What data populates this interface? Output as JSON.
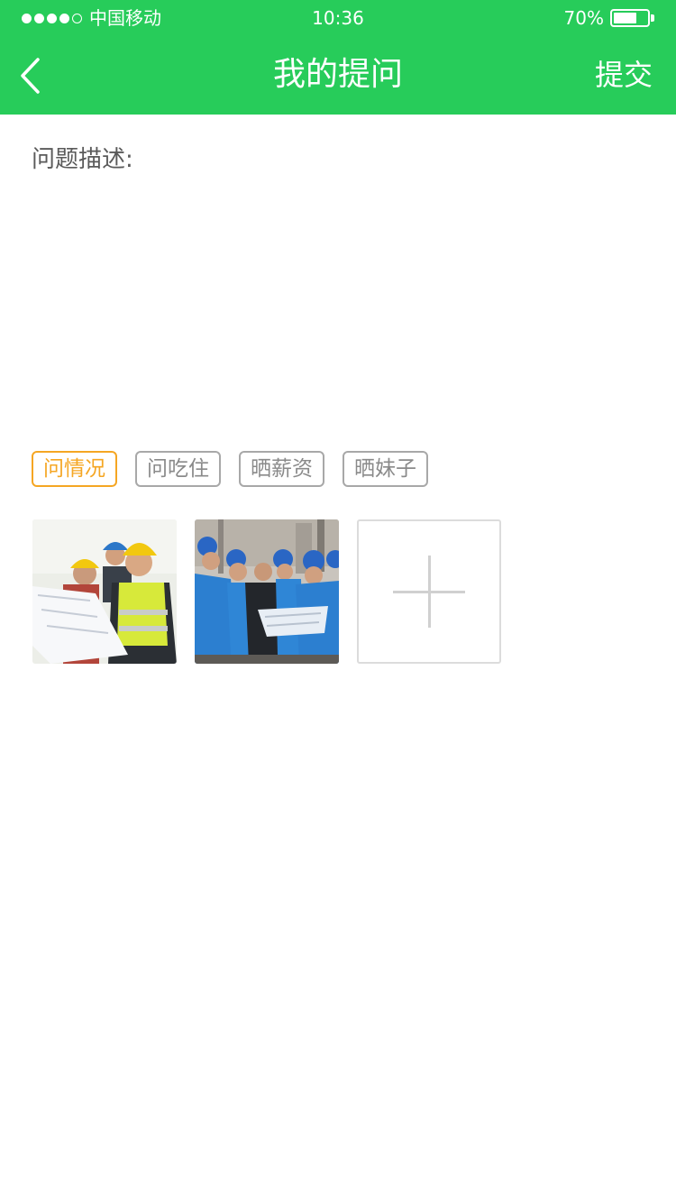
{
  "status_bar": {
    "carrier": "中国移动",
    "time": "10:36",
    "battery_percent": "70%",
    "battery_level": 0.7,
    "signal_bars": 4,
    "signal_total": 5
  },
  "nav": {
    "back_icon": "chevron-left-icon",
    "title": "我的提问",
    "submit_label": "提交"
  },
  "form": {
    "description_label": "问题描述:",
    "description_value": ""
  },
  "tags": [
    {
      "label": "问情况",
      "active": true
    },
    {
      "label": "问吃住",
      "active": false
    },
    {
      "label": "晒薪资",
      "active": false
    },
    {
      "label": "晒妹子",
      "active": false
    }
  ],
  "photos": {
    "add_icon": "plus-icon"
  },
  "colors": {
    "brand": "#27cc5a",
    "tag_active": "#f5a623",
    "tag_inactive": "#a8a8a8"
  }
}
